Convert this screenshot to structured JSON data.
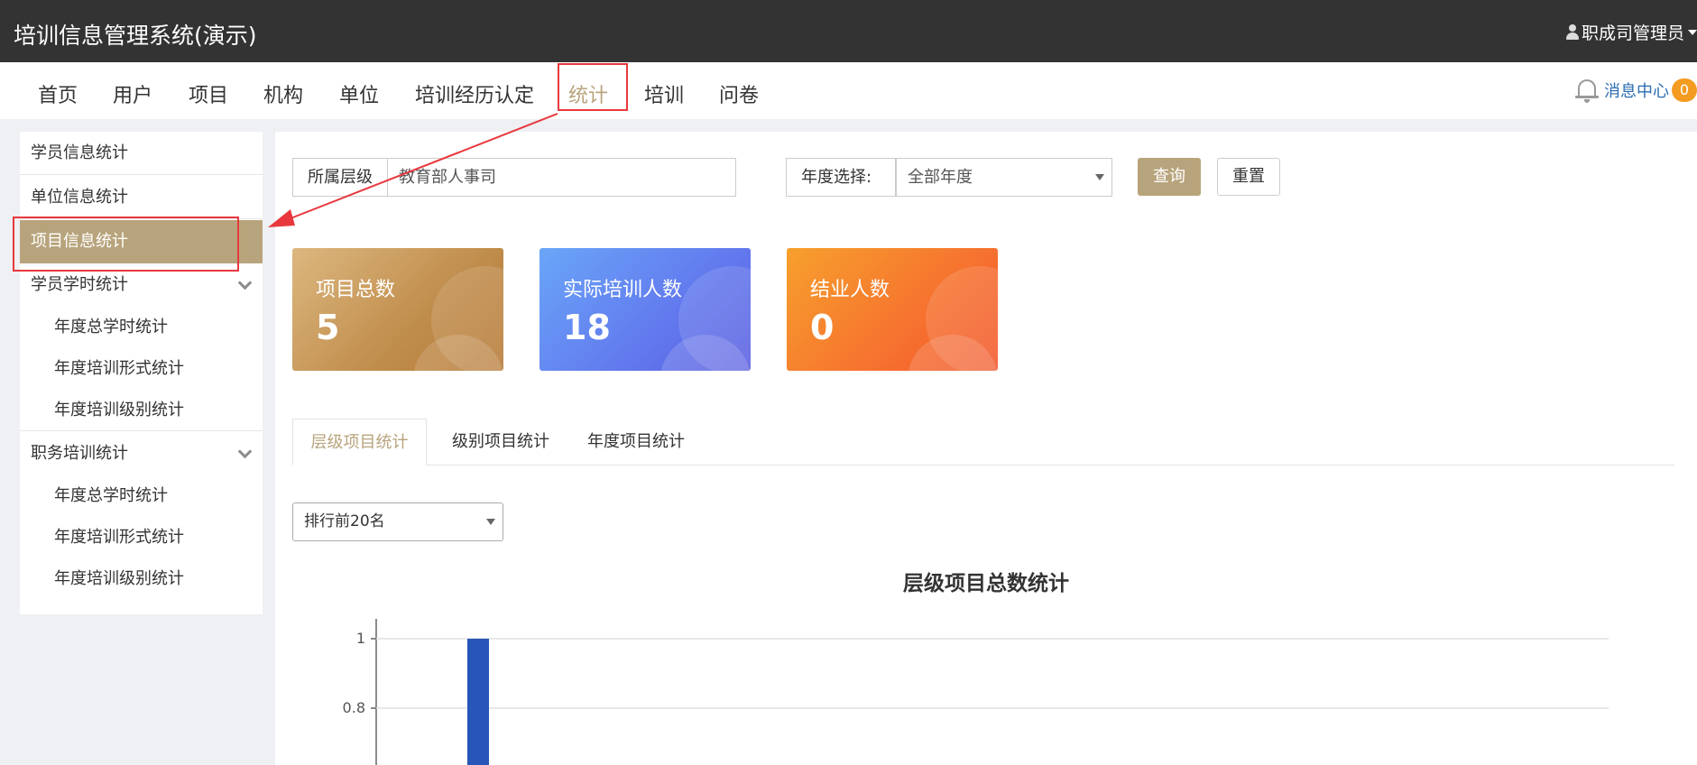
{
  "app": {
    "title": "培训信息管理系统(演示)",
    "user": "职成司管理员"
  },
  "nav": {
    "items": [
      "首页",
      "用户",
      "项目",
      "机构",
      "单位",
      "培训经历认定",
      "统计",
      "培训",
      "问卷"
    ],
    "active_index": 6,
    "message_center": "消息中心",
    "message_count": "0"
  },
  "sidebar": {
    "groups": [
      {
        "label": "学员信息统计"
      },
      {
        "label": "单位信息统计"
      },
      {
        "label": "项目信息统计",
        "active": true
      },
      {
        "label": "学员学时统计",
        "children": [
          "年度总学时统计",
          "年度培训形式统计",
          "年度培训级别统计"
        ]
      },
      {
        "label": "职务培训统计",
        "children": [
          "年度总学时统计",
          "年度培训形式统计",
          "年度培训级别统计"
        ]
      }
    ]
  },
  "filters": {
    "level_label": "所属层级",
    "level_value": "教育部人事司",
    "year_label": "年度选择:",
    "year_value": "全部年度",
    "query_button": "查询",
    "reset_button": "重置"
  },
  "cards": [
    {
      "label": "项目总数",
      "value": "5"
    },
    {
      "label": "实际培训人数",
      "value": "18"
    },
    {
      "label": "结业人数",
      "value": "0"
    }
  ],
  "tabs": [
    "层级项目统计",
    "级别项目统计",
    "年度项目统计"
  ],
  "rank_select": "排行前20名",
  "chart_data": {
    "type": "bar",
    "title": "层级项目总数统计",
    "yticks": [
      "1",
      "0.8"
    ],
    "ylim": [
      0,
      1
    ],
    "values": [
      1
    ],
    "grid": true,
    "bar_color": "#2756b8"
  },
  "colors": {
    "accent": "#b8a47c",
    "highlight": "#e8383d",
    "topbar": "#333333"
  }
}
